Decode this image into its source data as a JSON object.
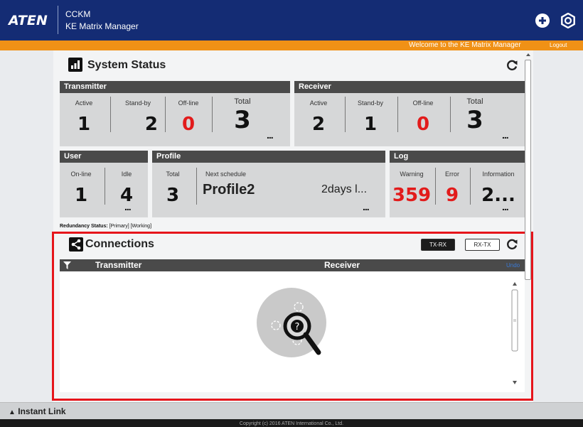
{
  "header": {
    "logo": "ATEN",
    "app_line1": "CCKM",
    "app_line2": "KE Matrix Manager"
  },
  "banner": {
    "welcome": "Welcome to the KE Matrix Manager",
    "logout": "Logout"
  },
  "system_status": {
    "title": "System Status",
    "transmitter": {
      "title": "Transmitter",
      "active_label": "Active",
      "active": "1",
      "standby_label": "Stand-by",
      "standby": "2",
      "offline_label": "Off-line",
      "offline": "0",
      "total_label": "Total",
      "total": "3"
    },
    "receiver": {
      "title": "Receiver",
      "active_label": "Active",
      "active": "2",
      "standby_label": "Stand-by",
      "standby": "1",
      "offline_label": "Off-line",
      "offline": "0",
      "total_label": "Total",
      "total": "3"
    },
    "user": {
      "title": "User",
      "online_label": "On-line",
      "online": "1",
      "idle_label": "Idle",
      "idle": "4"
    },
    "profile": {
      "title": "Profile",
      "total_label": "Total",
      "total": "3",
      "next_label": "Next schedule",
      "next": "Profile2",
      "when": "2days l..."
    },
    "log": {
      "title": "Log",
      "warning_label": "Warning",
      "warning": "359",
      "error_label": "Error",
      "error": "9",
      "info_label": "Information",
      "info": "2..."
    },
    "more": "..."
  },
  "redundancy": {
    "label": "Redundancy Status:",
    "value": "[Primary] [Working]"
  },
  "connections": {
    "title": "Connections",
    "tx_rx": "TX-RX",
    "rx_tx": "RX-TX",
    "col_transmitter": "Transmitter",
    "col_receiver": "Receiver",
    "undo": "Undo"
  },
  "bottom": {
    "instant_link": "Instant Link",
    "copyright": "Copyright (c) 2016 ATEN International Co., Ltd."
  },
  "colors": {
    "header": "#142c74",
    "orange": "#f09116",
    "highlight": "#e6151b",
    "alert": "#e21b1b"
  }
}
